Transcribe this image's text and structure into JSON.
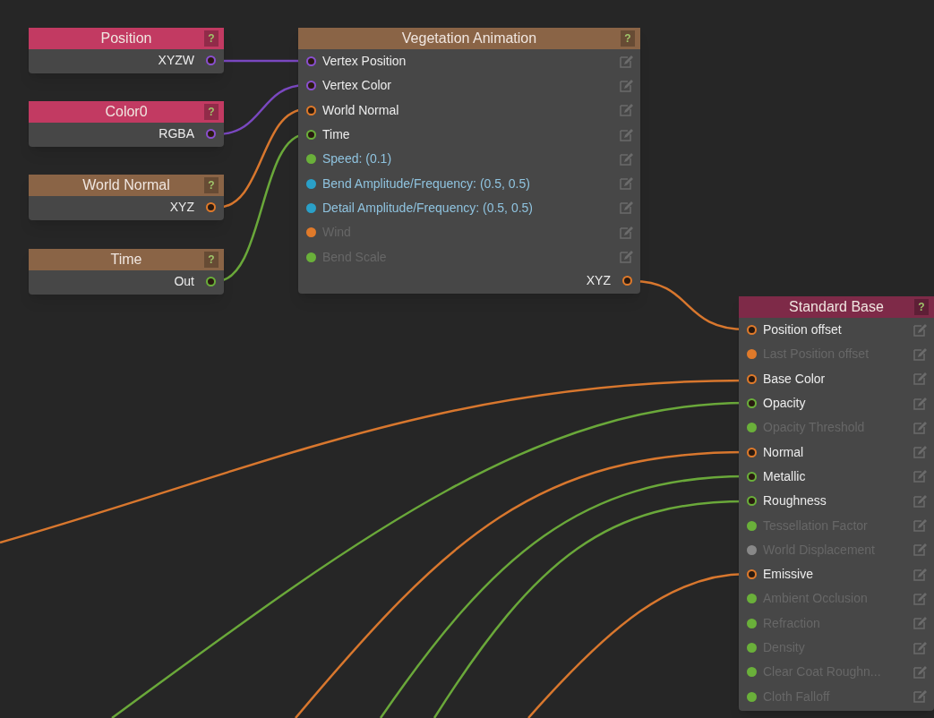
{
  "nodes": [
    {
      "title": "Position",
      "help": "?",
      "color": "#c23a62",
      "outputs": [
        {
          "label": "XYZW",
          "color": "#8a4fd0",
          "connected": true
        }
      ]
    },
    {
      "title": "Color0",
      "help": "?",
      "color": "#c23a62",
      "outputs": [
        {
          "label": "RGBA",
          "color": "#8a4fd0",
          "connected": true
        }
      ]
    },
    {
      "title": "World Normal",
      "help": "?",
      "color": "#8a6446",
      "outputs": [
        {
          "label": "XYZ",
          "color": "#e07a2a",
          "connected": true
        }
      ]
    },
    {
      "title": "Time",
      "help": "?",
      "color": "#8a6446",
      "outputs": [
        {
          "label": "Out",
          "color": "#6ab03a",
          "connected": true
        }
      ]
    },
    {
      "title": "Vegetation Animation",
      "help": "?",
      "color": "#8a6446",
      "inputs": [
        {
          "label": "Vertex Position",
          "kind": "input",
          "color": "#8a4fd0",
          "connected": true
        },
        {
          "label": "Vertex Color",
          "kind": "input",
          "color": "#8a4fd0",
          "connected": true
        },
        {
          "label": "World Normal",
          "kind": "input",
          "color": "#e07a2a",
          "connected": true
        },
        {
          "label": "Time",
          "kind": "input",
          "color": "#6ab03a",
          "connected": true
        },
        {
          "label": "Speed: (0.1)",
          "kind": "value",
          "color": "#6ab03a",
          "connected": false
        },
        {
          "label": "Bend Amplitude/Frequency: (0.5, 0.5)",
          "kind": "value",
          "color": "#2aa0c8",
          "connected": false
        },
        {
          "label": "Detail Amplitude/Frequency: (0.5, 0.5)",
          "kind": "value",
          "color": "#2aa0c8",
          "connected": false
        },
        {
          "label": "Wind",
          "kind": "disabled",
          "color": "#e07a2a",
          "connected": false
        },
        {
          "label": "Bend Scale",
          "kind": "disabled",
          "color": "#6ab03a",
          "connected": false
        }
      ],
      "outputs": [
        {
          "label": "XYZ",
          "color": "#e07a2a",
          "connected": true
        }
      ]
    },
    {
      "title": "Standard Base",
      "help": "?",
      "color": "#7e2a48",
      "inputs": [
        {
          "label": "Position offset",
          "kind": "input",
          "color": "#e07a2a",
          "connected": true
        },
        {
          "label": "Last Position offset",
          "kind": "disabled",
          "color": "#e07a2a",
          "connected": false
        },
        {
          "label": "Base Color",
          "kind": "input",
          "color": "#e07a2a",
          "connected": true
        },
        {
          "label": "Opacity",
          "kind": "input",
          "color": "#6ab03a",
          "connected": true
        },
        {
          "label": "Opacity Threshold",
          "kind": "disabled",
          "color": "#6ab03a",
          "connected": false
        },
        {
          "label": "Normal",
          "kind": "input",
          "color": "#e07a2a",
          "connected": true
        },
        {
          "label": "Metallic",
          "kind": "input",
          "color": "#6ab03a",
          "connected": true
        },
        {
          "label": "Roughness",
          "kind": "input",
          "color": "#6ab03a",
          "connected": true
        },
        {
          "label": "Tessellation Factor",
          "kind": "disabled",
          "color": "#6ab03a",
          "connected": false
        },
        {
          "label": "World Displacement",
          "kind": "disabled",
          "color": "#888888",
          "connected": false
        },
        {
          "label": "Emissive",
          "kind": "input",
          "color": "#e07a2a",
          "connected": true
        },
        {
          "label": "Ambient Occlusion",
          "kind": "disabled",
          "color": "#6ab03a",
          "connected": false
        },
        {
          "label": "Refraction",
          "kind": "disabled",
          "color": "#6ab03a",
          "connected": false
        },
        {
          "label": "Density",
          "kind": "disabled",
          "color": "#6ab03a",
          "connected": false
        },
        {
          "label": "Clear Coat Roughn...",
          "kind": "disabled",
          "color": "#6ab03a",
          "connected": false
        },
        {
          "label": "Cloth Falloff",
          "kind": "disabled",
          "color": "#6ab03a",
          "connected": false
        }
      ]
    }
  ]
}
